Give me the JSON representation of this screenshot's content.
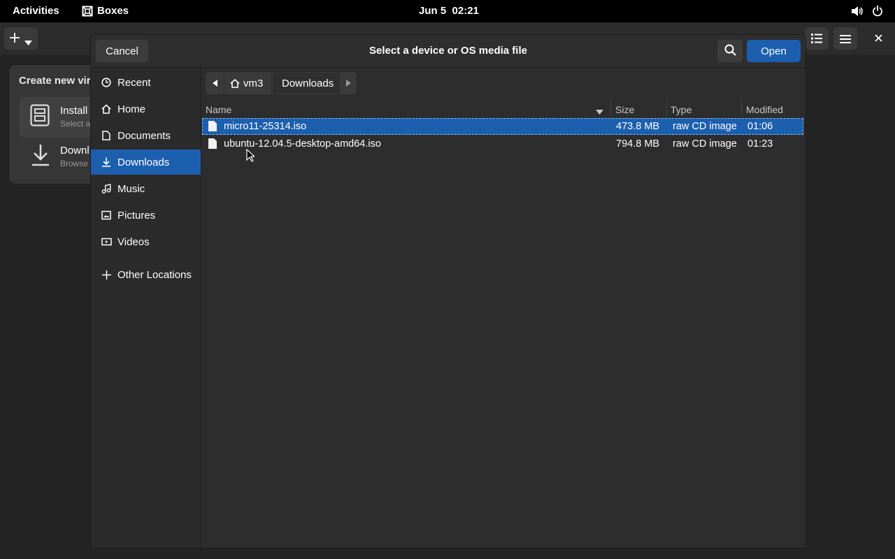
{
  "topbar": {
    "activities": "Activities",
    "app_name": "Boxes",
    "datetime": "Jun 5  02:21"
  },
  "background_app": {
    "popover_title": "Create new virt",
    "install_title": "Install",
    "install_sub": "Select a",
    "download_title": "Downl",
    "download_sub": "Browse"
  },
  "dialog": {
    "title": "Select a device or OS media file",
    "cancel_label": "Cancel",
    "open_label": "Open"
  },
  "sidebar": {
    "items": [
      {
        "label": "Recent",
        "icon": "clock-icon"
      },
      {
        "label": "Home",
        "icon": "home-icon"
      },
      {
        "label": "Documents",
        "icon": "document-icon"
      },
      {
        "label": "Downloads",
        "icon": "download-icon"
      },
      {
        "label": "Music",
        "icon": "music-icon"
      },
      {
        "label": "Pictures",
        "icon": "picture-icon"
      },
      {
        "label": "Videos",
        "icon": "video-icon"
      }
    ],
    "other_locations": "Other Locations"
  },
  "path": {
    "segments": [
      "vm3",
      "Downloads"
    ]
  },
  "columns": {
    "name": "Name",
    "size": "Size",
    "type": "Type",
    "modified": "Modified"
  },
  "files": [
    {
      "name": "micro11-25314.iso",
      "size": "473.8 MB",
      "type": "raw CD image",
      "modified": "01:06",
      "selected": true
    },
    {
      "name": "ubuntu-12.04.5-desktop-amd64.iso",
      "size": "794.8 MB",
      "type": "raw CD image",
      "modified": "01:23",
      "selected": false
    }
  ],
  "colors": {
    "accent": "#1c5fae",
    "topbar": "#000000"
  }
}
